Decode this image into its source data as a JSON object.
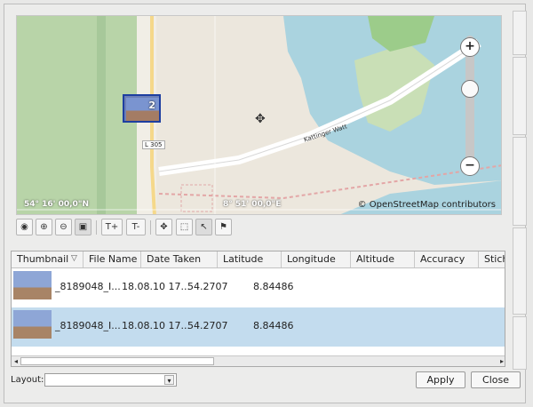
{
  "map": {
    "coord_left": "54° 16' 00,0\"N",
    "coord_right": "8° 51' 00,0\"E",
    "attribution": "© OpenStreetMap contributors",
    "road_label": "L 305",
    "water_label": "Kattinger Watt",
    "cluster_count": "2",
    "zoom_in": "+",
    "zoom_out": "−"
  },
  "toolbar": {
    "zoom_plus": "T+",
    "zoom_minus": "T-"
  },
  "table": {
    "columns": [
      "Thumbnail",
      "File Name",
      "Date Taken",
      "Latitude",
      "Longitude",
      "Altitude",
      "Accuracy",
      "Stich"
    ],
    "rows": [
      {
        "file": "_8189048_I...",
        "date": "18.08.10 17...",
        "lat": "54.2707",
        "lon": "8.84486"
      },
      {
        "file": "_8189048_I...",
        "date": "18.08.10 17...",
        "lat": "54.2707",
        "lon": "8.84486"
      }
    ]
  },
  "bottom": {
    "layout_label": "Layout:",
    "layout_value": "",
    "apply": "Apply",
    "close": "Close"
  }
}
